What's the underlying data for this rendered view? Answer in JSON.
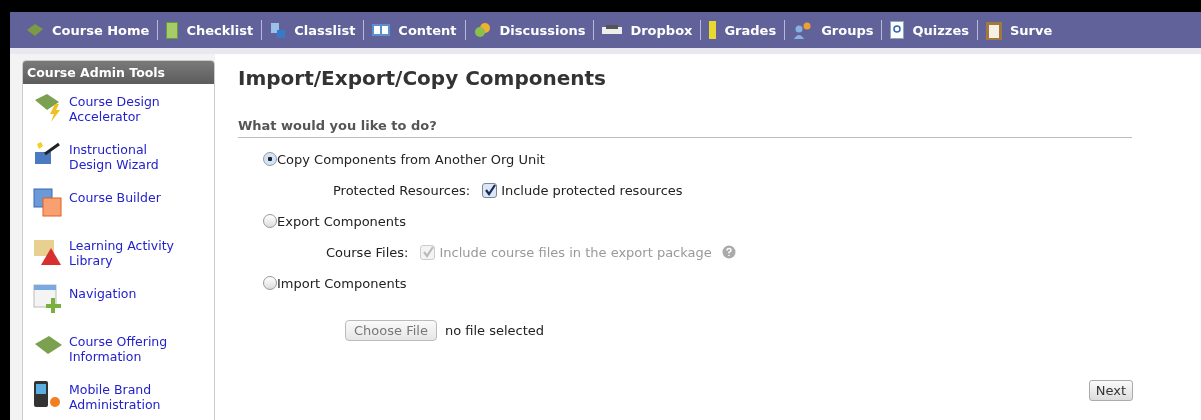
{
  "nav": [
    {
      "label": "Course Home"
    },
    {
      "label": "Checklist"
    },
    {
      "label": "Classlist"
    },
    {
      "label": "Content"
    },
    {
      "label": "Discussions"
    },
    {
      "label": "Dropbox"
    },
    {
      "label": "Grades"
    },
    {
      "label": "Groups"
    },
    {
      "label": "Quizzes"
    },
    {
      "label": "Surve"
    }
  ],
  "sidebar": {
    "title": "Course Admin Tools",
    "items": [
      {
        "label": "Course Design Accelerator"
      },
      {
        "label": "Instructional Design Wizard"
      },
      {
        "label": "Course Builder"
      },
      {
        "label": "Learning Activity Library"
      },
      {
        "label": "Navigation"
      },
      {
        "label": "Course Offering Information"
      },
      {
        "label": "Mobile Brand Administration"
      }
    ]
  },
  "page_title": "Import/Export/Copy Components",
  "section_heading": "What would you like to do?",
  "options": [
    {
      "label": "Copy Components from Another Org Unit",
      "selected": true,
      "sub": {
        "kind": "checkbox",
        "label": "Protected Resources:",
        "text": "Include protected resources",
        "checked": true,
        "disabled": false,
        "help": false
      }
    },
    {
      "label": "Export Components",
      "selected": false,
      "sub": {
        "kind": "checkbox",
        "label": "Course Files:",
        "text": "Include course files in the export package",
        "checked": true,
        "disabled": true,
        "help": true
      }
    },
    {
      "label": "Import Components",
      "selected": false,
      "sub": {
        "kind": "file",
        "button": "Choose File",
        "text": "no file selected"
      }
    }
  ],
  "next_button": "Next"
}
